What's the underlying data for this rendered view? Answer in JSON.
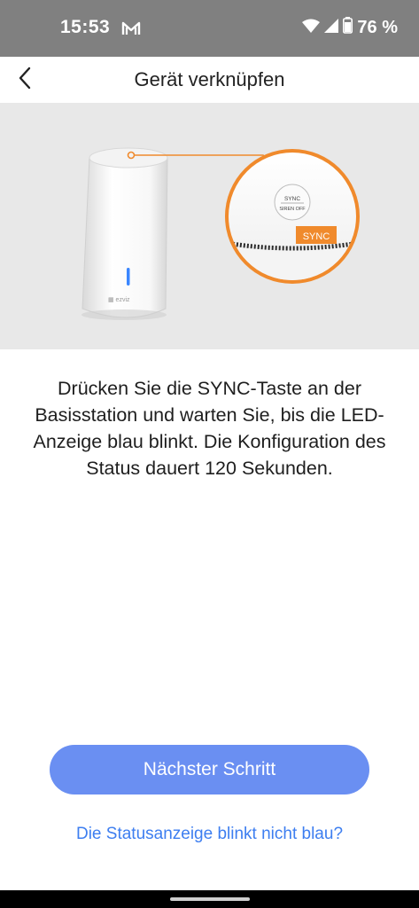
{
  "status_bar": {
    "time": "15:53",
    "battery": "76 %",
    "icons": [
      "mail-icon",
      "wifi-icon",
      "signal-icon",
      "battery-icon"
    ]
  },
  "header": {
    "back_icon": "chevron-left-icon",
    "title": "Gerät verknüpfen"
  },
  "illustration": {
    "brand": "ezviz",
    "button_text_line1": "SYNC",
    "button_text_line2": "SIREN OFF",
    "sync_label": "SYNC",
    "accent_color": "#f08a2c",
    "led_color": "#3a86ff"
  },
  "instruction": "Drücken Sie die SYNC-Taste an der Basisstation und warten Sie, bis die LED-Anzeige blau blinkt. Die Konfiguration des Status dauert 120 Sekunden.",
  "primary_button": {
    "label": "Nächster Schritt",
    "color": "#6a8ff2"
  },
  "help_link": {
    "label": "Die Statusanzeige blinkt nicht blau?",
    "color": "#3d7ef0"
  }
}
